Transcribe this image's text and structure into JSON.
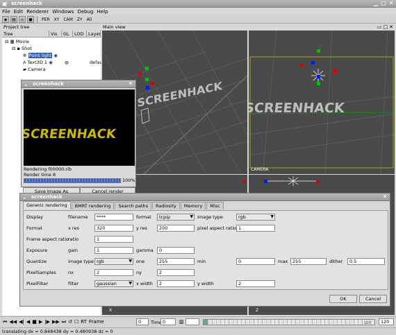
{
  "main_window": {
    "title": "screenhack",
    "menu": [
      "File",
      "Edit",
      "Renderer",
      "Windows",
      "Debug",
      "Help"
    ],
    "toolbar": [
      "PER",
      "XY",
      "CAM",
      "ZY",
      "All"
    ]
  },
  "project_panel": {
    "title": "Project tree",
    "columns": [
      "Tree",
      "Vis",
      "GL",
      "LOD",
      "Layer"
    ],
    "items": [
      {
        "label": "Movie"
      },
      {
        "label": "Shot"
      },
      {
        "label": "Point light"
      },
      {
        "label": "Text3D 1",
        "layer": "defau"
      },
      {
        "label": "Camera"
      }
    ]
  },
  "main_view": {
    "title": "Main view",
    "logo_text": "SCREENHACK",
    "camera_label": "CAMERA",
    "axis_x": "X",
    "axis_z": "Z"
  },
  "render_window": {
    "title": "screenhack",
    "logo_text": "SCREENHACK",
    "status1": "Rendering f00000.rib",
    "status2": "Render time 8",
    "progress_text": "100%",
    "progress": 1.0,
    "save_label": "Save Image As",
    "cancel_label": "Cancel render"
  },
  "settings_dialog": {
    "title": "screenhack",
    "tabs": [
      "Generic rendering",
      "BMRT rendering",
      "Search paths",
      "Radiosity",
      "Memory",
      "Misc"
    ],
    "labels": {
      "display": "Display",
      "filename": "filename",
      "format_lbl": "format",
      "image_type": "image type",
      "format": "Format",
      "xres": "x res",
      "yres": "y res",
      "par": "pixel aspect ratio",
      "frame_ar": "Frame aspect ratio",
      "ratio": "ratio",
      "exposure": "Exposure",
      "gain": "gain",
      "gamma": "gamma",
      "quantize": "Quantize",
      "image_type2": "image type",
      "one": "one",
      "min": "min",
      "max": "max",
      "dither": "dither",
      "pixsamples": "PixelSamples",
      "nx": "nx",
      "ny": "ny",
      "pixfilter": "PixelFilter",
      "filter": "filter",
      "xwidth": "x width",
      "ywidth": "y width"
    },
    "values": {
      "filename": "****",
      "format": "tcpip",
      "image_type": "rgb",
      "xres": "320",
      "yres": "200",
      "par": "1",
      "ratio": "1",
      "gain": "1",
      "gamma": "0",
      "qtype": "rgb",
      "one": "255",
      "min": "0",
      "max": "255",
      "dither": "0.5",
      "nx": "2",
      "ny": "2",
      "filter": "gaussian",
      "xwidth": "2",
      "ywidth": "2"
    },
    "ok_label": "OK",
    "cancel_label": "Cancel"
  },
  "timeline": {
    "rt_label": "RT",
    "frame_label": "Frame",
    "frame_value": "0",
    "time_label": "Time",
    "time_value": "0",
    "end_value": "120",
    "end_marker": "120"
  },
  "statusbar": {
    "text": "translating dx = 0.848438 dy = 0.480938 dz = 0"
  }
}
